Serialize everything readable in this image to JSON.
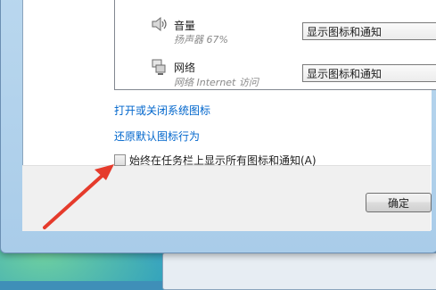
{
  "notifications": {
    "rows": [
      {
        "name": "音量",
        "sub": "扬声器 67%",
        "icon": "speaker-icon",
        "behavior": "显示图标和通知"
      },
      {
        "name": "网络",
        "sub": "网络 Internet 访问",
        "icon": "network-icon",
        "behavior": "显示图标和通知"
      }
    ]
  },
  "links": {
    "turn_system_icons": "打开或关闭系统图标",
    "restore_defaults": "还原默认图标行为"
  },
  "always_show": {
    "label": "始终在任务栏上显示所有图标和通知(A)",
    "checked": false
  },
  "footer": {
    "ok_label": "确定"
  },
  "colors": {
    "link": "#0066cc",
    "annotation_arrow": "#e53b2c"
  }
}
